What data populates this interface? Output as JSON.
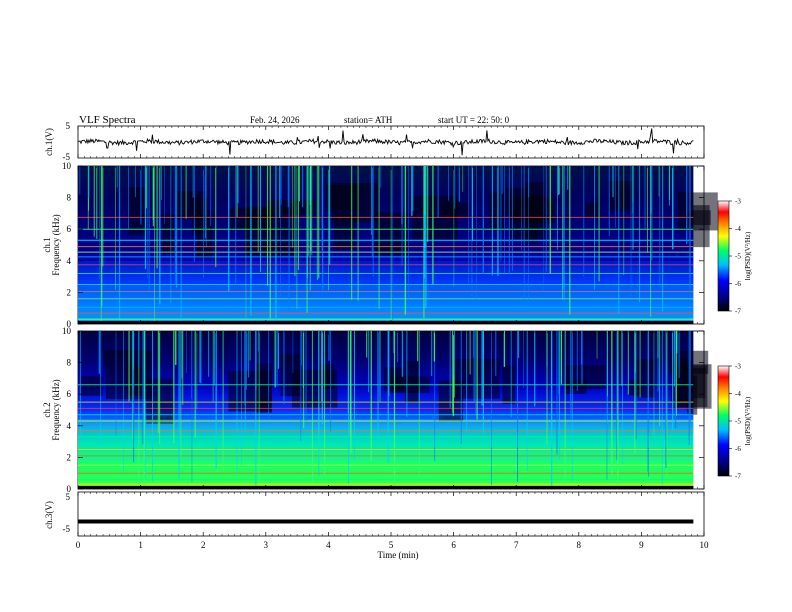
{
  "header": {
    "title": "VLF  Spectra",
    "date": "Feb. 24, 2026",
    "station": "station= ATH",
    "start": "start  UT  =    22: 50: 0"
  },
  "chart_data": {
    "type": "heatmap",
    "x_axis": {
      "label": "Time  (min)",
      "range": [
        0,
        10
      ],
      "ticks": [
        "0",
        "1",
        "2",
        "3",
        "4",
        "5",
        "6",
        "7",
        "8",
        "9",
        "10"
      ],
      "data_end": 9.83
    },
    "panels": [
      {
        "id": "ch1-waveform",
        "type": "line",
        "ylabel": "ch.1(V)",
        "yrange": [
          -5,
          5
        ],
        "ticks": [
          "5",
          "-5"
        ]
      },
      {
        "id": "ch1-spectrogram",
        "type": "heatmap",
        "ylabel_line1": "ch.1",
        "ylabel_line2": "Frequency  (kHz)",
        "yrange": [
          0,
          10
        ],
        "ticks": [
          "0",
          "2",
          "4",
          "6",
          "8",
          "10"
        ],
        "colorbar": {
          "label": "log(PSD)(V²/Hz)",
          "range": [
            -7,
            -3
          ],
          "ticks": [
            "-3",
            "-4",
            "-5",
            "-6",
            "-7"
          ]
        },
        "bands_khz": [
          0.05,
          0.3,
          0.7,
          1.05,
          1.6,
          2.05,
          2.5,
          3.2,
          3.75,
          4.25,
          4.55,
          4.9,
          5.3,
          6.0,
          6.75
        ]
      },
      {
        "id": "ch2-spectrogram",
        "type": "heatmap",
        "ylabel_line1": "ch.2",
        "ylabel_line2": "Frequency  (kHz)",
        "yrange": [
          0,
          10
        ],
        "ticks": [
          "0",
          "2",
          "4",
          "6",
          "8",
          "10"
        ],
        "colorbar": {
          "label": "log(PSD)(V²/Hz)",
          "range": [
            -7,
            -3
          ],
          "ticks": [
            "-3",
            "-4",
            "-5",
            "-6",
            "-7"
          ]
        },
        "bands_khz": [
          0.05,
          0.3,
          0.6,
          1.0,
          1.5,
          1.9,
          2.1,
          2.5,
          3.3,
          3.7,
          4.3,
          4.7,
          5.1,
          5.5,
          6.6
        ]
      },
      {
        "id": "ch3-waveform",
        "type": "line",
        "ylabel": "ch.3(V)",
        "yrange": [
          -5,
          5
        ],
        "ticks": [
          "5",
          "-5"
        ],
        "level_v": -1.7
      }
    ]
  }
}
